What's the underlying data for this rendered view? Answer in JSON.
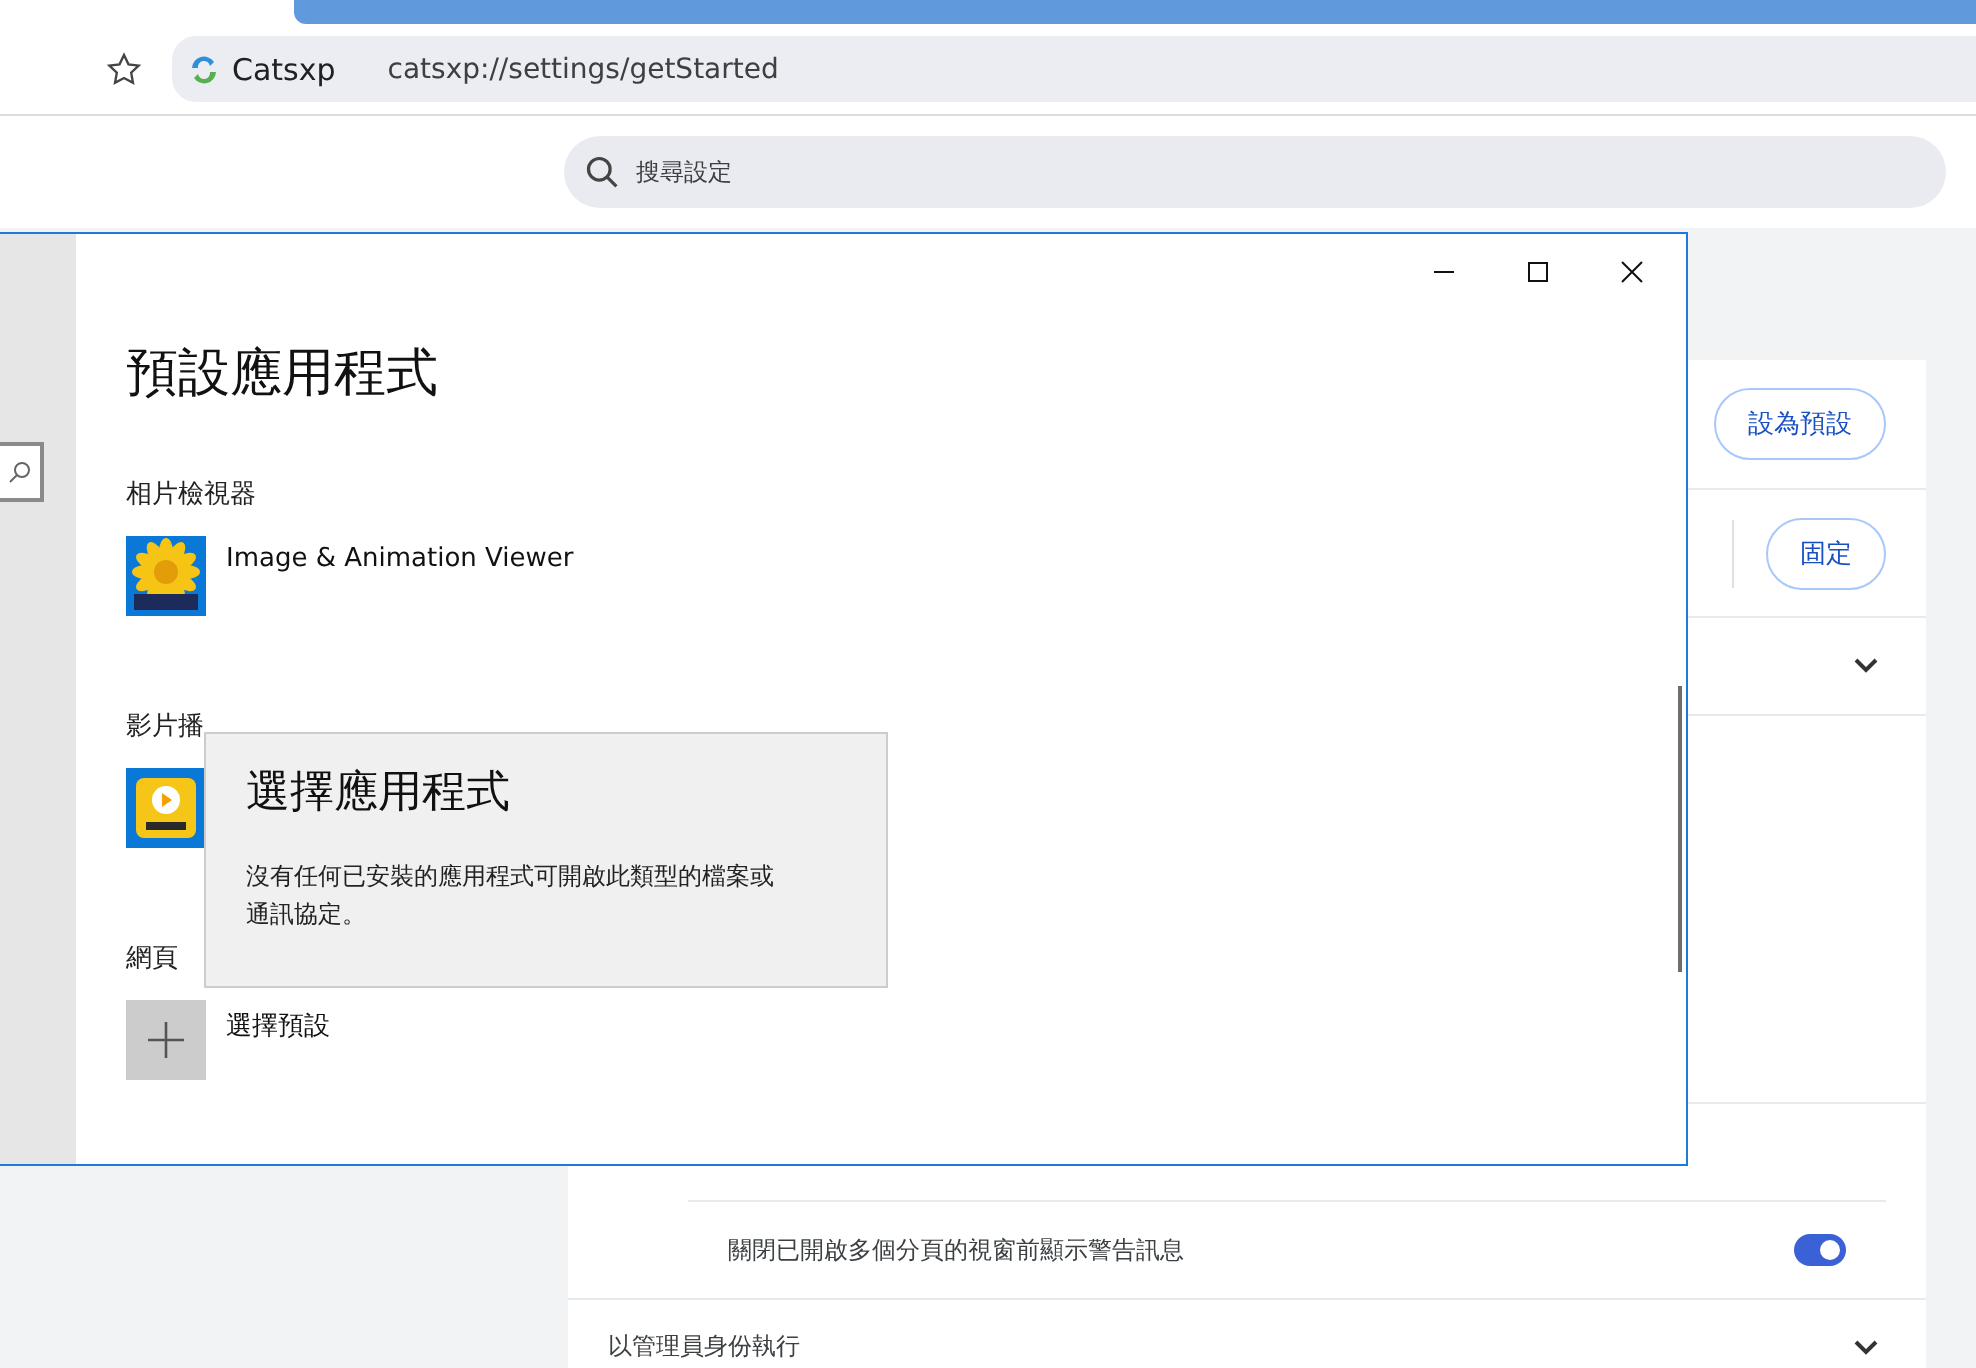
{
  "browser": {
    "site_name": "Catsxp",
    "url": "catsxp://settings/getStarted",
    "search": {
      "placeholder": "搜尋設定"
    }
  },
  "settings": {
    "buttons": [
      "設為預設",
      "固定"
    ],
    "toggle_row": {
      "label": "關閉已開啟多個分頁的視窗前顯示警告訊息",
      "on": true
    },
    "expand_row": {
      "label": "以管理員身份執行"
    }
  },
  "dialog": {
    "title": "預設應用程式",
    "sections": [
      {
        "heading": "相片檢視器",
        "app": {
          "name": "Image & Animation Viewer",
          "kind": "flower"
        }
      },
      {
        "heading": "影片播",
        "app": {
          "kind": "player"
        }
      },
      {
        "heading": "網頁",
        "app": {
          "name": "選擇預設",
          "kind": "add"
        }
      }
    ]
  },
  "flyout": {
    "title": "選擇應用程式",
    "message": "沒有任何已安裝的應用程式可開啟此類型的檔案或通訊協定。"
  }
}
